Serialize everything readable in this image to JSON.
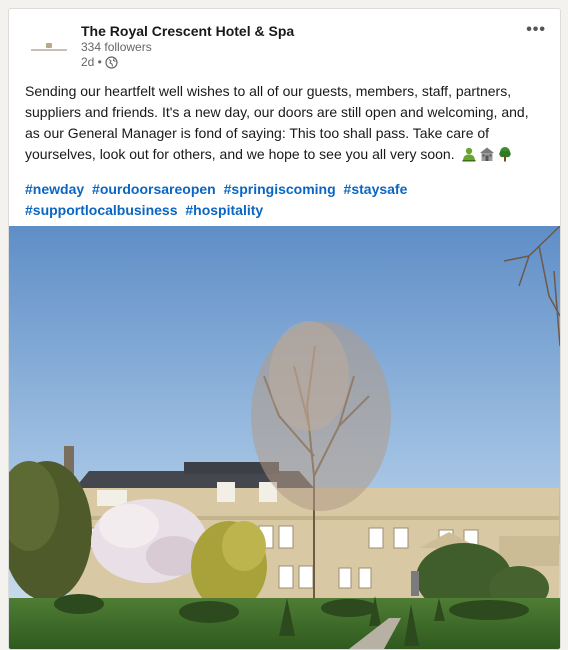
{
  "company": {
    "name": "The Royal Crescent Hotel & Spa",
    "followers": "334 followers",
    "posted_ago": "2d •"
  },
  "post": {
    "text": "Sending our heartfelt well wishes to all of our guests, members, staff, partners, suppliers and friends. It's a new day, our doors are still open and welcoming, and, as our General Manager is fond of saying: This too shall pass. Take care of yourselves, look out for others, and we hope to see you all very soon.",
    "emojis": [
      "person-icon",
      "house-icon",
      "tree-icon"
    ],
    "hashtags": [
      "#newday",
      "#ourdoorsareopen",
      "#springiscoming",
      "#staysafe",
      "#supportlocalbusiness",
      "#hospitality"
    ]
  },
  "icons": {
    "more": "•••",
    "visibility": "globe-icon"
  },
  "colors": {
    "link": "#0a66c2",
    "sky_top": "#6b95c9",
    "lawn": "#3f6a2c"
  }
}
